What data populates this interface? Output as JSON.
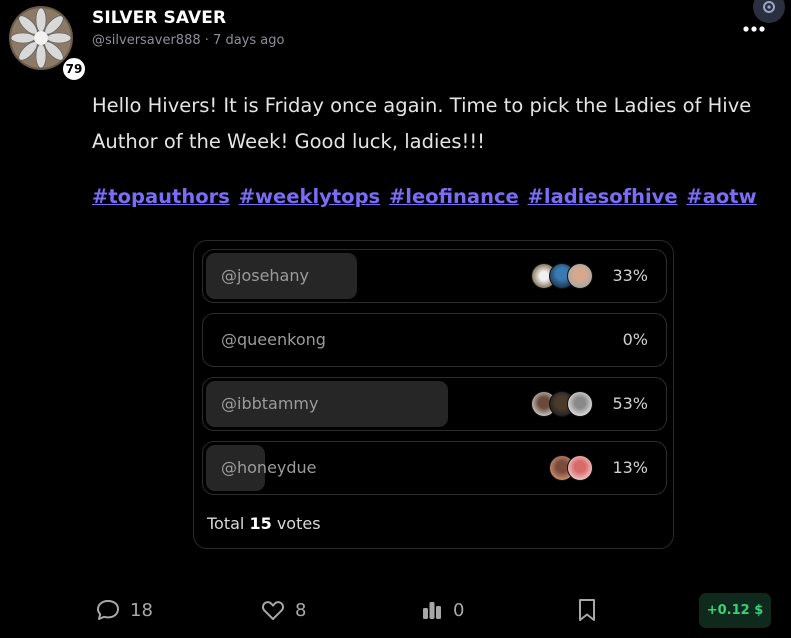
{
  "author": {
    "name": "SILVER SAVER",
    "handle": "@silversaver888",
    "separator": "·",
    "time_ago": "7 days ago",
    "reputation": "79"
  },
  "post": {
    "body": "Hello Hivers! It is Friday once again. Time to pick the Ladies of Hive Author of the Week! Good luck, ladies!!!",
    "hashtags": [
      "#topauthors",
      "#weeklytops",
      "#leofinance",
      "#ladiesofhive",
      "#aotw"
    ]
  },
  "poll": {
    "options": [
      {
        "label": "@josehany",
        "percent_text": "33%",
        "percent": 33
      },
      {
        "label": "@queenkong",
        "percent_text": "0%",
        "percent": 0
      },
      {
        "label": "@ibbtammy",
        "percent_text": "53%",
        "percent": 53
      },
      {
        "label": "@honeydue",
        "percent_text": "13%",
        "percent": 13
      }
    ],
    "total_prefix": "Total",
    "total_votes": "15",
    "total_suffix": "votes"
  },
  "actions": {
    "comments": "18",
    "likes": "8",
    "votes": "0",
    "payout": "+0.12 $"
  },
  "icons": {
    "more": "more-horizontal-icon",
    "settings": "settings-icon",
    "comment": "comment-icon",
    "like": "heart-icon",
    "vote": "bar-chart-icon",
    "bookmark": "bookmark-icon"
  },
  "colors": {
    "background": "#000000",
    "hashtag": "#7b6cf6",
    "payout_text": "#36d27a",
    "payout_bg": "#0f2a1c"
  }
}
